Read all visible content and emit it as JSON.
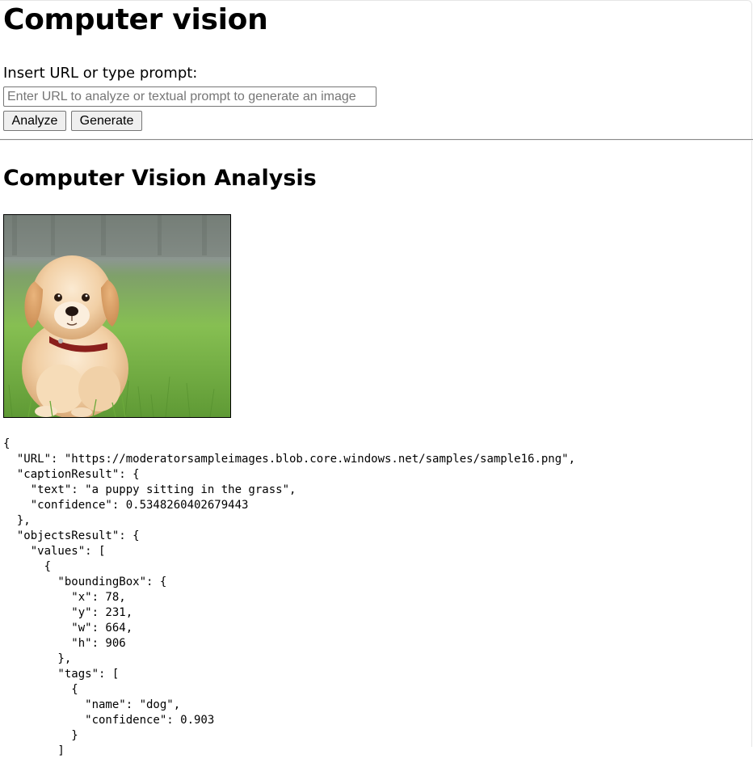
{
  "header": {
    "title": "Computer vision"
  },
  "form": {
    "label": "Insert URL or type prompt:",
    "input_value": "",
    "input_placeholder": "Enter URL to analyze or textual prompt to generate an image",
    "analyze_label": "Analyze",
    "generate_label": "Generate"
  },
  "results": {
    "section_title": "Computer Vision Analysis",
    "image_icon": "puppy-photo",
    "json_text": "{\n  \"URL\": \"https://moderatorsampleimages.blob.core.windows.net/samples/sample16.png\",\n  \"captionResult\": {\n    \"text\": \"a puppy sitting in the grass\",\n    \"confidence\": 0.5348260402679443\n  },\n  \"objectsResult\": {\n    \"values\": [\n      {\n        \"boundingBox\": {\n          \"x\": 78,\n          \"y\": 231,\n          \"w\": 664,\n          \"h\": 906\n        },\n        \"tags\": [\n          {\n            \"name\": \"dog\",\n            \"confidence\": 0.903\n          }\n        ]"
  },
  "colors": {
    "button_bg": "#efefef",
    "border": "#767676",
    "divider": "#8a8a8a"
  }
}
